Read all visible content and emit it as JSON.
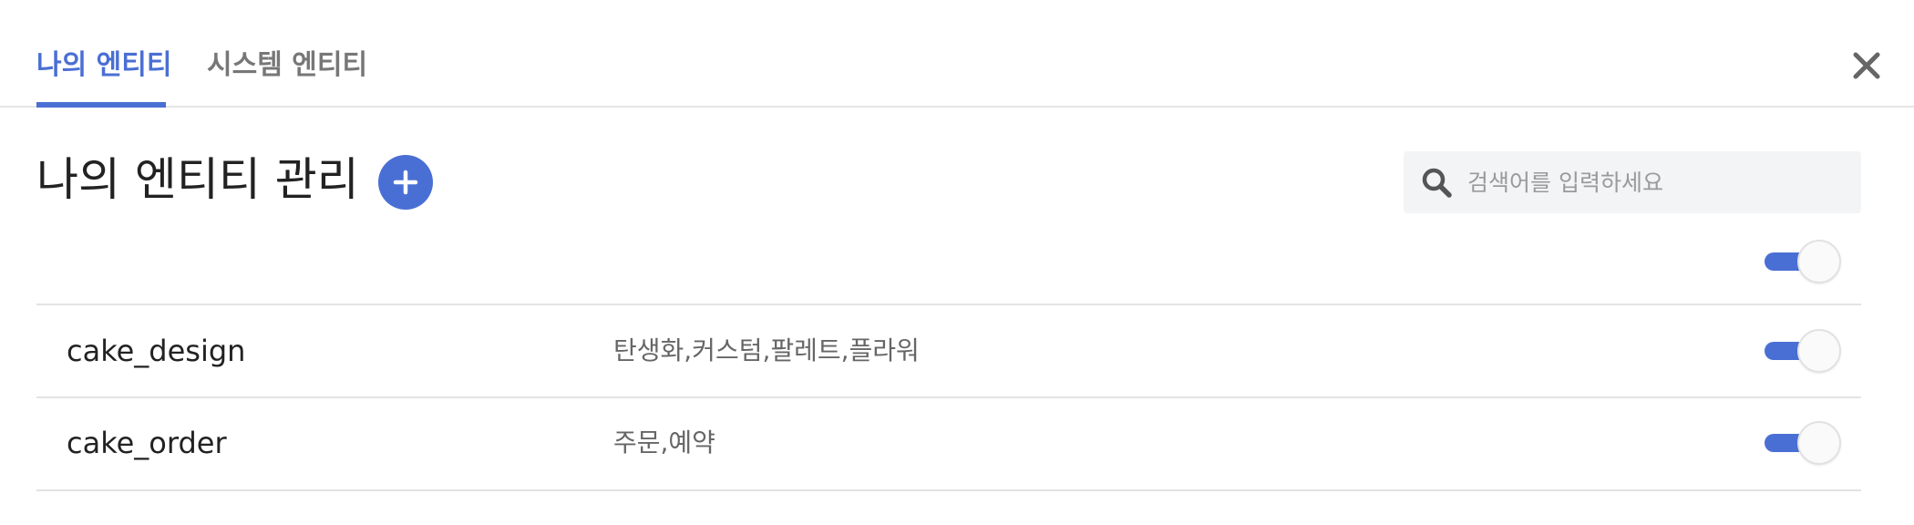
{
  "tabs": [
    {
      "label": "나의 엔티티",
      "active": true
    },
    {
      "label": "시스템 엔티티",
      "active": false
    }
  ],
  "header": {
    "title": "나의 엔티티 관리"
  },
  "search": {
    "placeholder": "검색어를 입력하세요",
    "value": ""
  },
  "toggle_all": {
    "on": true
  },
  "entities": [
    {
      "name": "cake_design",
      "synonyms": "탄생화,커스텀,팔레트,플라워",
      "enabled": true
    },
    {
      "name": "cake_order",
      "synonyms": "주문,예약",
      "enabled": true
    }
  ],
  "icons": {
    "close": "close-icon",
    "add": "plus-icon",
    "search": "search-icon"
  },
  "colors": {
    "accent": "#4a6fd4",
    "inactive_tab": "#777777",
    "divider": "#e3e3e3",
    "search_bg": "#f3f4f6"
  }
}
